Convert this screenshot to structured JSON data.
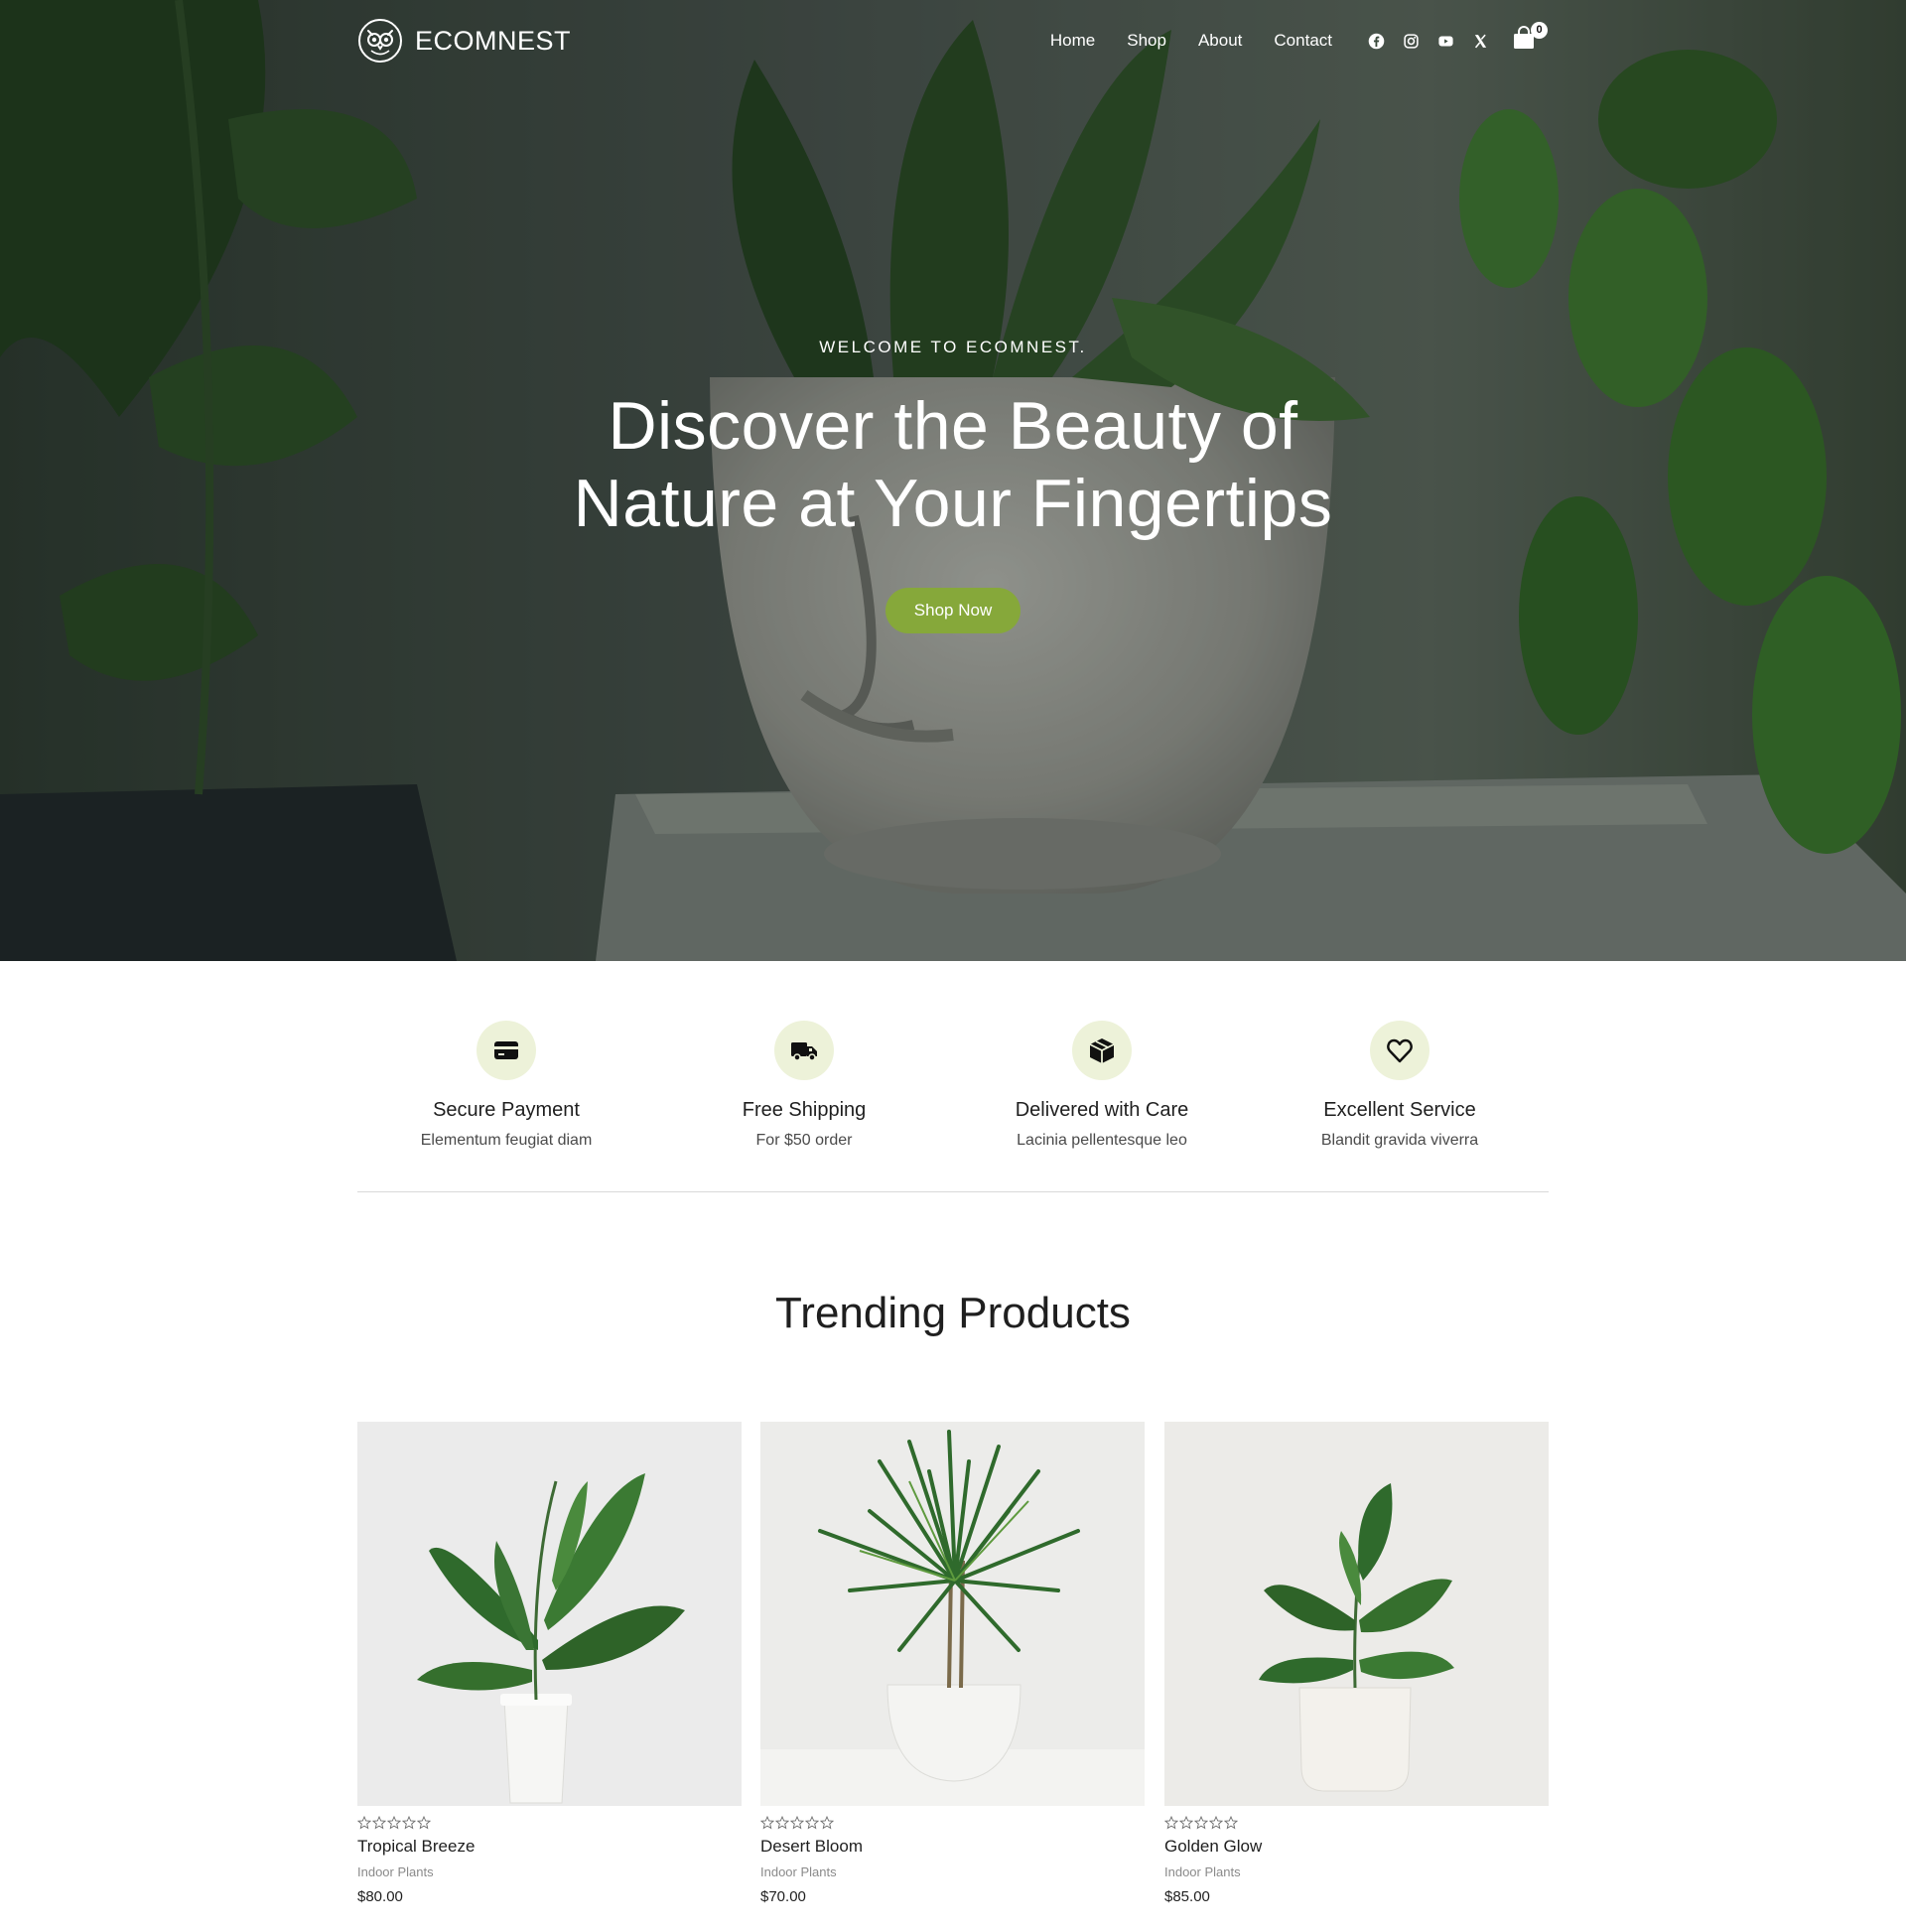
{
  "brand": {
    "name": "ECOMNEST"
  },
  "nav": {
    "items": [
      "Home",
      "Shop",
      "About",
      "Contact"
    ]
  },
  "socials": {
    "icons": [
      "facebook-icon",
      "instagram-icon",
      "youtube-icon",
      "x-icon"
    ]
  },
  "cart": {
    "count": "0"
  },
  "hero": {
    "eyebrow": "WELCOME TO ECOMNEST.",
    "title": "Discover the Beauty of Nature at Your Fingertips",
    "button": "Shop Now"
  },
  "features": [
    {
      "title": "Secure Payment",
      "subtitle": "Elementum feugiat diam",
      "icon": "credit-card-icon"
    },
    {
      "title": "Free Shipping",
      "subtitle": "For $50 order",
      "icon": "truck-icon"
    },
    {
      "title": "Delivered with Care",
      "subtitle": "Lacinia pellentesque leo",
      "icon": "box-icon"
    },
    {
      "title": "Excellent Service",
      "subtitle": "Blandit gravida viverra",
      "icon": "heart-icon"
    }
  ],
  "trending": {
    "title": "Trending Products",
    "products": [
      {
        "name": "Tropical Breeze",
        "category": "Indoor Plants",
        "price": "$80.00",
        "rating": 0
      },
      {
        "name": "Desert Bloom",
        "category": "Indoor Plants",
        "price": "$70.00",
        "rating": 0
      },
      {
        "name": "Golden Glow",
        "category": "Indoor Plants",
        "price": "$85.00",
        "rating": 0
      }
    ]
  },
  "colors": {
    "accent": "#86a83a",
    "icon_bg": "#edf2d9",
    "text": "#1f1f1f"
  }
}
